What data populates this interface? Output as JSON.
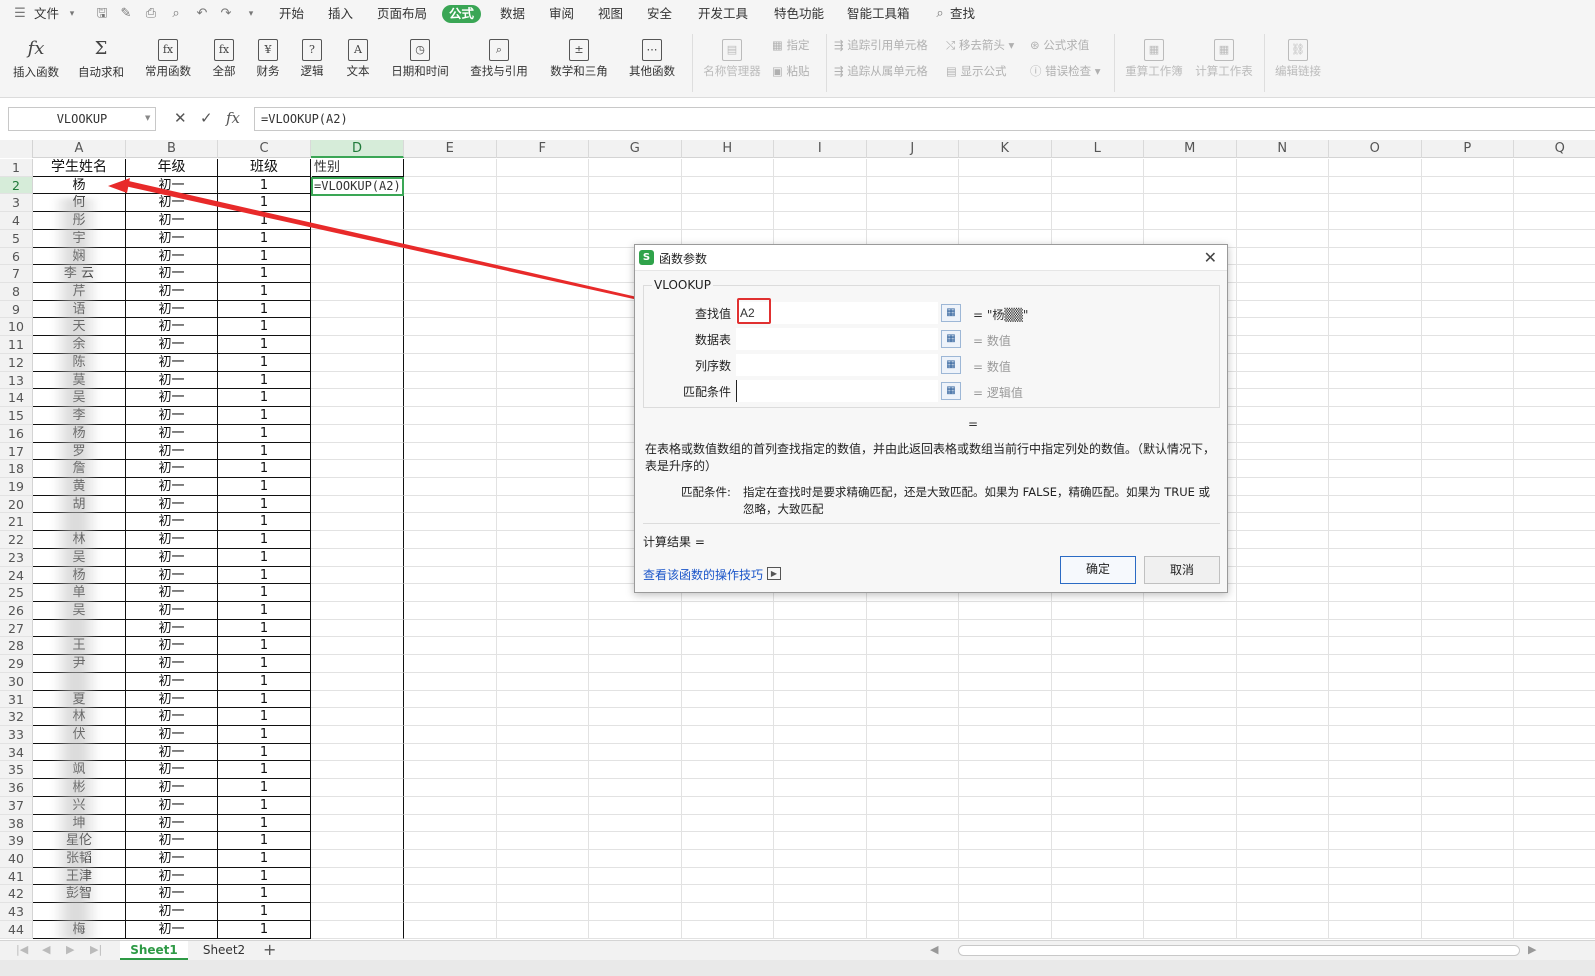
{
  "menu": {
    "file": "文件",
    "tabs": [
      "开始",
      "插入",
      "页面布局",
      "公式",
      "数据",
      "审阅",
      "视图",
      "安全",
      "开发工具",
      "特色功能",
      "智能工具箱"
    ],
    "active_tab": "公式",
    "search": "查找"
  },
  "ribbon": {
    "insert_function": "插入函数",
    "autosum": "自动求和",
    "common_functions": "常用函数",
    "all": "全部",
    "finance": "财务",
    "logic": "逻辑",
    "text": "文本",
    "datetime": "日期和时间",
    "lookup": "查找与引用",
    "math": "数学和三角",
    "other": "其他函数",
    "name_manager": "名称管理器",
    "define": "指定",
    "paste": "粘贴",
    "trace_precedents": "追踪引用单元格",
    "trace_dependents": "追踪从属单元格",
    "remove_arrows": "移去箭头",
    "show_formulas": "显示公式",
    "evaluate": "公式求值",
    "error_check": "错误检查",
    "recalc_workbook": "重算工作簿",
    "calc_sheet": "计算工作表",
    "edit_links": "编辑链接"
  },
  "formula_bar": {
    "name_box": "VLOOKUP",
    "formula": "=VLOOKUP(A2)"
  },
  "columns": [
    "A",
    "B",
    "C",
    "D",
    "E",
    "F",
    "G",
    "H",
    "I",
    "J",
    "K",
    "L",
    "M",
    "N",
    "O",
    "P",
    "Q"
  ],
  "selected_column": "D",
  "headers": {
    "A": "学生姓名",
    "B": "年级",
    "C": "班级",
    "D": "性别"
  },
  "editing_cell": "=VLOOKUP(A2)",
  "rows": [
    [
      "杨",
      "初一",
      "1"
    ],
    [
      "何",
      "初一",
      "1"
    ],
    [
      "彤",
      "初一",
      "1"
    ],
    [
      "宇",
      "初一",
      "1"
    ],
    [
      "娴",
      "初一",
      "1"
    ],
    [
      "李 云",
      "初一",
      "1"
    ],
    [
      "芹",
      "初一",
      "1"
    ],
    [
      "语",
      "初一",
      "1"
    ],
    [
      "天",
      "初一",
      "1"
    ],
    [
      "余",
      "初一",
      "1"
    ],
    [
      "陈",
      "初一",
      "1"
    ],
    [
      "莫",
      "初一",
      "1"
    ],
    [
      "吴",
      "初一",
      "1"
    ],
    [
      "李",
      "初一",
      "1"
    ],
    [
      "杨",
      "初一",
      "1"
    ],
    [
      "罗",
      "初一",
      "1"
    ],
    [
      "詹",
      "初一",
      "1"
    ],
    [
      "黄",
      "初一",
      "1"
    ],
    [
      "胡",
      "初一",
      "1"
    ],
    [
      "",
      "初一",
      "1"
    ],
    [
      "林",
      "初一",
      "1"
    ],
    [
      "吴",
      "初一",
      "1"
    ],
    [
      "杨",
      "初一",
      "1"
    ],
    [
      "单",
      "初一",
      "1"
    ],
    [
      "吴",
      "初一",
      "1"
    ],
    [
      "",
      "初一",
      "1"
    ],
    [
      "王",
      "初一",
      "1"
    ],
    [
      "尹",
      "初一",
      "1"
    ],
    [
      "",
      "初一",
      "1"
    ],
    [
      "夏",
      "初一",
      "1"
    ],
    [
      "林",
      "初一",
      "1"
    ],
    [
      "伏",
      "初一",
      "1"
    ],
    [
      "",
      "初一",
      "1"
    ],
    [
      "飒",
      "初一",
      "1"
    ],
    [
      "彬",
      "初一",
      "1"
    ],
    [
      "兴",
      "初一",
      "1"
    ],
    [
      "坤",
      "初一",
      "1"
    ],
    [
      "星伦",
      "初一",
      "1"
    ],
    [
      "张韬",
      "初一",
      "1"
    ],
    [
      "王津",
      "初一",
      "1"
    ],
    [
      "彭智",
      "初一",
      "1"
    ],
    [
      "",
      "初一",
      "1"
    ],
    [
      "梅",
      "初一",
      "1"
    ]
  ],
  "dialog": {
    "title": "函数参数",
    "function": "VLOOKUP",
    "args": [
      {
        "label": "查找值",
        "value": "A2",
        "result": "= \"杨▒▒\""
      },
      {
        "label": "数据表",
        "value": "",
        "result": "= 数值"
      },
      {
        "label": "列序数",
        "value": "",
        "result": "= 数值"
      },
      {
        "label": "匹配条件",
        "value": "",
        "result": "= 逻辑值"
      }
    ],
    "eq": "=",
    "description": "在表格或数值数组的首列查找指定的数值，并由此返回表格或数组当前行中指定列处的数值。（默认情况下，表是升序的）",
    "cond_label": "匹配条件:",
    "cond_desc": "指定在查找时是要求精确匹配，还是大致匹配。如果为 FALSE，精确匹配。如果为 TRUE 或忽略，大致匹配",
    "result": "计算结果 =",
    "help_link": "查看该函数的操作技巧",
    "ok": "确定",
    "cancel": "取消"
  },
  "sheets": [
    "Sheet1",
    "Sheet2"
  ],
  "active_sheet": "Sheet1",
  "colors": {
    "accent": "#3aa655",
    "arrow": "#e82a2a"
  }
}
